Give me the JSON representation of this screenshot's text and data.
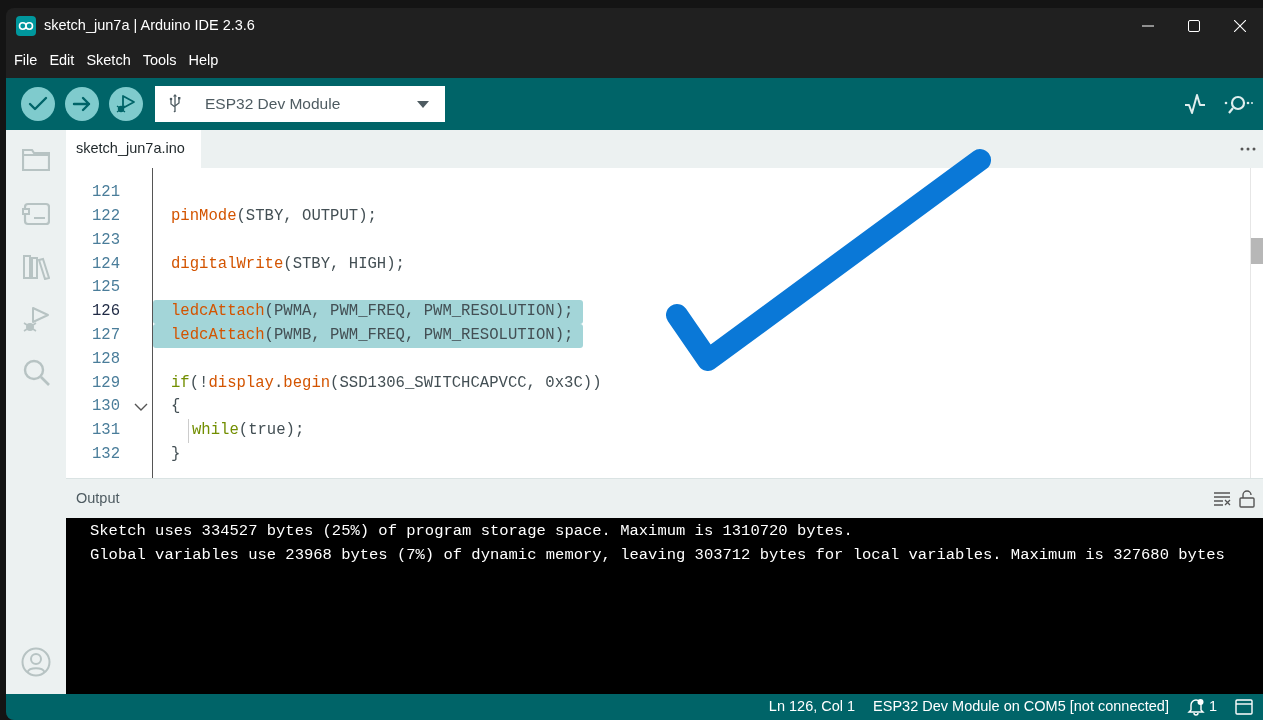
{
  "window": {
    "title": "sketch_jun7a | Arduino IDE 2.3.6"
  },
  "menu": [
    "File",
    "Edit",
    "Sketch",
    "Tools",
    "Help"
  ],
  "toolbar": {
    "board": "ESP32 Dev Module"
  },
  "tabs": [
    {
      "label": "sketch_jun7a.ino",
      "selected": true
    }
  ],
  "editor": {
    "lines": [
      {
        "number": "121",
        "selected": false,
        "current": false,
        "foldable": false,
        "indented": false
      },
      {
        "number": "122",
        "selected": false,
        "current": false,
        "foldable": false,
        "indented": false,
        "tokens": [
          {
            "kind": "function",
            "text": "pinMode"
          },
          {
            "kind": "plain",
            "text": "(STBY, OUTPUT);"
          }
        ]
      },
      {
        "number": "123",
        "selected": false,
        "current": false,
        "foldable": false,
        "indented": false
      },
      {
        "number": "124",
        "selected": false,
        "current": false,
        "foldable": false,
        "indented": false,
        "tokens": [
          {
            "kind": "function",
            "text": "digitalWrite"
          },
          {
            "kind": "plain",
            "text": "(STBY, HIGH);"
          }
        ]
      },
      {
        "number": "125",
        "selected": false,
        "current": false,
        "foldable": false,
        "indented": false
      },
      {
        "number": "126",
        "selected": true,
        "current": true,
        "foldable": false,
        "indented": false,
        "tokens": [
          {
            "kind": "function",
            "text": "ledcAttach"
          },
          {
            "kind": "plain",
            "text": "(PWMA, PWM_FREQ, PWM_RESOLUTION);"
          }
        ]
      },
      {
        "number": "127",
        "selected": true,
        "current": false,
        "foldable": false,
        "indented": false,
        "tokens": [
          {
            "kind": "function",
            "text": "ledcAttach"
          },
          {
            "kind": "plain",
            "text": "(PWMB, PWM_FREQ, PWM_RESOLUTION);"
          }
        ]
      },
      {
        "number": "128",
        "selected": false,
        "current": false,
        "foldable": false,
        "indented": false
      },
      {
        "number": "129",
        "selected": false,
        "current": false,
        "foldable": false,
        "indented": false,
        "tokens": [
          {
            "kind": "keyword",
            "text": "if"
          },
          {
            "kind": "plain",
            "text": "(!"
          },
          {
            "kind": "function",
            "text": "display"
          },
          {
            "kind": "plain",
            "text": "."
          },
          {
            "kind": "function",
            "text": "begin"
          },
          {
            "kind": "plain",
            "text": "(SSD1306_SWITCHCAPVCC, 0x3C))"
          }
        ]
      },
      {
        "number": "130",
        "selected": false,
        "current": false,
        "foldable": true,
        "indented": false,
        "tokens": [
          {
            "kind": "plain",
            "text": "{"
          }
        ]
      },
      {
        "number": "131",
        "selected": false,
        "current": false,
        "foldable": false,
        "indented": true,
        "tokens": [
          {
            "kind": "keyword",
            "text": "while"
          },
          {
            "kind": "plain",
            "text": "(true);"
          }
        ]
      },
      {
        "number": "132",
        "selected": false,
        "current": false,
        "foldable": false,
        "indented": false,
        "tokens": [
          {
            "kind": "plain",
            "text": "}"
          }
        ]
      }
    ]
  },
  "annotation": {
    "kind": "checkmark"
  },
  "output": {
    "title": "Output",
    "lines": [
      "Sketch uses 334527 bytes (25%) of program storage space. Maximum is 1310720 bytes.",
      "Global variables use 23968 bytes (7%) of dynamic memory, leaving 303712 bytes for local variables. Maximum is 327680 bytes"
    ]
  },
  "status_bar": {
    "position": "Ln 126, Col 1",
    "board": "ESP32 Dev Module on COM5 [not connected]",
    "notifications": "1"
  }
}
